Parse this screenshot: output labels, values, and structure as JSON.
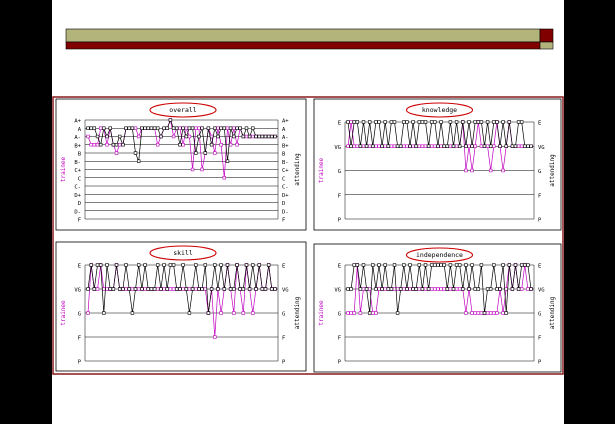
{
  "colors": {
    "background": "#000000",
    "slide": "#ffffff",
    "header_olive": "#b3b37c",
    "header_maroon": "#800000",
    "frame": "#8b1a1a",
    "trainee": "#c000c0",
    "attending": "#000000",
    "grid": "#000000",
    "title_ellipse": "#cc0000"
  },
  "chart_data": [
    {
      "type": "line",
      "title": "overall",
      "ylabel_left": "trainee",
      "ylabel_right": "attending",
      "y_ticks": [
        "A+",
        "A",
        "A-",
        "B+",
        "B",
        "B-",
        "C+",
        "C",
        "C-",
        "D+",
        "D",
        "D-",
        "F"
      ],
      "grid": true,
      "series": [
        {
          "name": "attending",
          "values": [
            "A",
            "A",
            "A",
            "A-",
            "B+",
            "A",
            "A-",
            "A",
            "B+",
            "B+",
            "A-",
            "B+",
            "A",
            "A",
            "A",
            "B",
            "B-",
            "A",
            "A",
            "A",
            "A",
            "A",
            "A",
            "A-",
            "A",
            "A",
            "A+",
            "A",
            "A",
            "B+",
            "A",
            "A-",
            "A",
            "A",
            "B",
            "A-",
            "A",
            "B",
            "A",
            "B+",
            "A",
            "A-",
            "A",
            "A",
            "B-",
            "A",
            "A-",
            "A",
            "A",
            "A-",
            "A",
            "A-",
            "A",
            "A-",
            "A-",
            "A-",
            "A-",
            "A-",
            "A-",
            "A-"
          ]
        },
        {
          "name": "trainee",
          "values": [
            "A-",
            "B+",
            "B+",
            "B+",
            "A",
            "A",
            "B+",
            "A",
            "B+",
            "B",
            "B+",
            "B+",
            "A",
            "A",
            "A",
            "A",
            "A-",
            "A",
            "A",
            "A",
            "A",
            "A",
            "B+",
            "A-",
            "A",
            "A",
            "A+",
            "A-",
            "A",
            "A",
            "B+",
            "A",
            "A-",
            "C+",
            "A",
            "A",
            "C+",
            "B",
            "A",
            "A-",
            "B",
            "A",
            "B+",
            "C",
            "A",
            "B+",
            "A",
            "B+",
            "A",
            "A-",
            "A-",
            "A-",
            "A-",
            "A-",
            "A-",
            "A-",
            "A-",
            "A-",
            "A-",
            "A-"
          ]
        }
      ]
    },
    {
      "type": "line",
      "title": "knowledge",
      "ylabel_left": "trainee",
      "ylabel_right": "attending",
      "y_ticks": [
        "E",
        "VG",
        "G",
        "F",
        "P"
      ],
      "grid": true,
      "series": [
        {
          "name": "attending",
          "values": [
            "E",
            "VG",
            "E",
            "E",
            "VG",
            "E",
            "VG",
            "E",
            "VG",
            "E",
            "E",
            "VG",
            "E",
            "VG",
            "E",
            "E",
            "VG",
            "VG",
            "E",
            "E",
            "VG",
            "E",
            "VG",
            "E",
            "E",
            "E",
            "VG",
            "E",
            "E",
            "VG",
            "E",
            "VG",
            "VG",
            "E",
            "VG",
            "E",
            "VG",
            "E",
            "VG",
            "E",
            "VG",
            "E",
            "E",
            "E",
            "VG",
            "E",
            "VG",
            "E",
            "E",
            "VG",
            "E",
            "VG",
            "E",
            "VG",
            "VG",
            "E",
            "E",
            "VG",
            "VG",
            "VG"
          ]
        },
        {
          "name": "trainee",
          "values": [
            "VG",
            "E",
            "VG",
            "VG",
            "VG",
            "VG",
            "VG",
            "VG",
            "VG",
            "VG",
            "VG",
            "VG",
            "VG",
            "VG",
            "VG",
            "VG",
            "VG",
            "VG",
            "VG",
            "VG",
            "VG",
            "VG",
            "VG",
            "VG",
            "VG",
            "VG",
            "VG",
            "VG",
            "VG",
            "VG",
            "VG",
            "VG",
            "VG",
            "VG",
            "VG",
            "VG",
            "VG",
            "E",
            "G",
            "VG",
            "G",
            "VG",
            "E",
            "VG",
            "VG",
            "VG",
            "G",
            "VG",
            "E",
            "VG",
            "G",
            "VG",
            "E",
            "VG",
            "VG",
            "VG",
            "VG",
            "VG",
            "VG",
            "VG"
          ]
        }
      ]
    },
    {
      "type": "line",
      "title": "skill",
      "ylabel_left": "trainee",
      "ylabel_right": "attending",
      "y_ticks": [
        "E",
        "VG",
        "G",
        "F",
        "P"
      ],
      "grid": true,
      "series": [
        {
          "name": "attending",
          "values": [
            "VG",
            "E",
            "VG",
            "E",
            "E",
            "G",
            "E",
            "VG",
            "VG",
            "E",
            "VG",
            "VG",
            "E",
            "VG",
            "G",
            "VG",
            "E",
            "VG",
            "E",
            "VG",
            "VG",
            "VG",
            "E",
            "VG",
            "E",
            "VG",
            "E",
            "E",
            "VG",
            "VG",
            "E",
            "VG",
            "G",
            "VG",
            "E",
            "VG",
            "VG",
            "E",
            "G",
            "VG",
            "E",
            "VG",
            "E",
            "VG",
            "E",
            "VG",
            "VG",
            "E",
            "VG",
            "VG",
            "E",
            "VG",
            "E",
            "VG",
            "E",
            "VG",
            "VG",
            "E",
            "VG",
            "VG"
          ]
        },
        {
          "name": "trainee",
          "values": [
            "G",
            "E",
            "VG",
            "VG",
            "E",
            "VG",
            "VG",
            "VG",
            "VG",
            "E",
            "VG",
            "VG",
            "VG",
            "VG",
            "VG",
            "VG",
            "VG",
            "VG",
            "VG",
            "VG",
            "VG",
            "VG",
            "VG",
            "VG",
            "VG",
            "VG",
            "VG",
            "VG",
            "VG",
            "VG",
            "VG",
            "VG",
            "VG",
            "VG",
            "VG",
            "VG",
            "VG",
            "VG",
            "G",
            "VG",
            "F",
            "VG",
            "G",
            "VG",
            "E",
            "VG",
            "G",
            "E",
            "VG",
            "G",
            "E",
            "VG",
            "G",
            "VG",
            "E",
            "VG",
            "VG",
            "E",
            "VG",
            "VG"
          ]
        }
      ]
    },
    {
      "type": "line",
      "title": "independence",
      "ylabel_left": "trainee",
      "ylabel_right": "attending",
      "y_ticks": [
        "E",
        "VG",
        "G",
        "F",
        "P"
      ],
      "grid": true,
      "series": [
        {
          "name": "attending",
          "values": [
            "VG",
            "VG",
            "E",
            "E",
            "VG",
            "E",
            "VG",
            "G",
            "E",
            "VG",
            "E",
            "VG",
            "E",
            "VG",
            "VG",
            "E",
            "G",
            "VG",
            "E",
            "VG",
            "E",
            "VG",
            "VG",
            "E",
            "VG",
            "E",
            "VG",
            "E",
            "E",
            "E",
            "E",
            "E",
            "VG",
            "E",
            "VG",
            "E",
            "E",
            "VG",
            "E",
            "VG",
            "E",
            "VG",
            "VG",
            "E",
            "G",
            "VG",
            "VG",
            "E",
            "VG",
            "VG",
            "E",
            "G",
            "E",
            "VG",
            "E",
            "VG",
            "E",
            "E",
            "E",
            "VG"
          ]
        },
        {
          "name": "trainee",
          "values": [
            "G",
            "G",
            "G",
            "E",
            "G",
            "VG",
            "VG",
            "VG",
            "G",
            "G",
            "VG",
            "VG",
            "VG",
            "VG",
            "VG",
            "VG",
            "VG",
            "VG",
            "VG",
            "VG",
            "VG",
            "VG",
            "VG",
            "VG",
            "VG",
            "VG",
            "VG",
            "VG",
            "VG",
            "VG",
            "VG",
            "VG",
            "VG",
            "VG",
            "VG",
            "VG",
            "VG",
            "VG",
            "G",
            "VG",
            "G",
            "G",
            "G",
            "G",
            "G",
            "G",
            "G",
            "G",
            "G",
            "VG",
            "G",
            "VG",
            "E",
            "VG",
            "E",
            "VG",
            "VG",
            "E",
            "VG",
            "VG"
          ]
        }
      ]
    }
  ]
}
